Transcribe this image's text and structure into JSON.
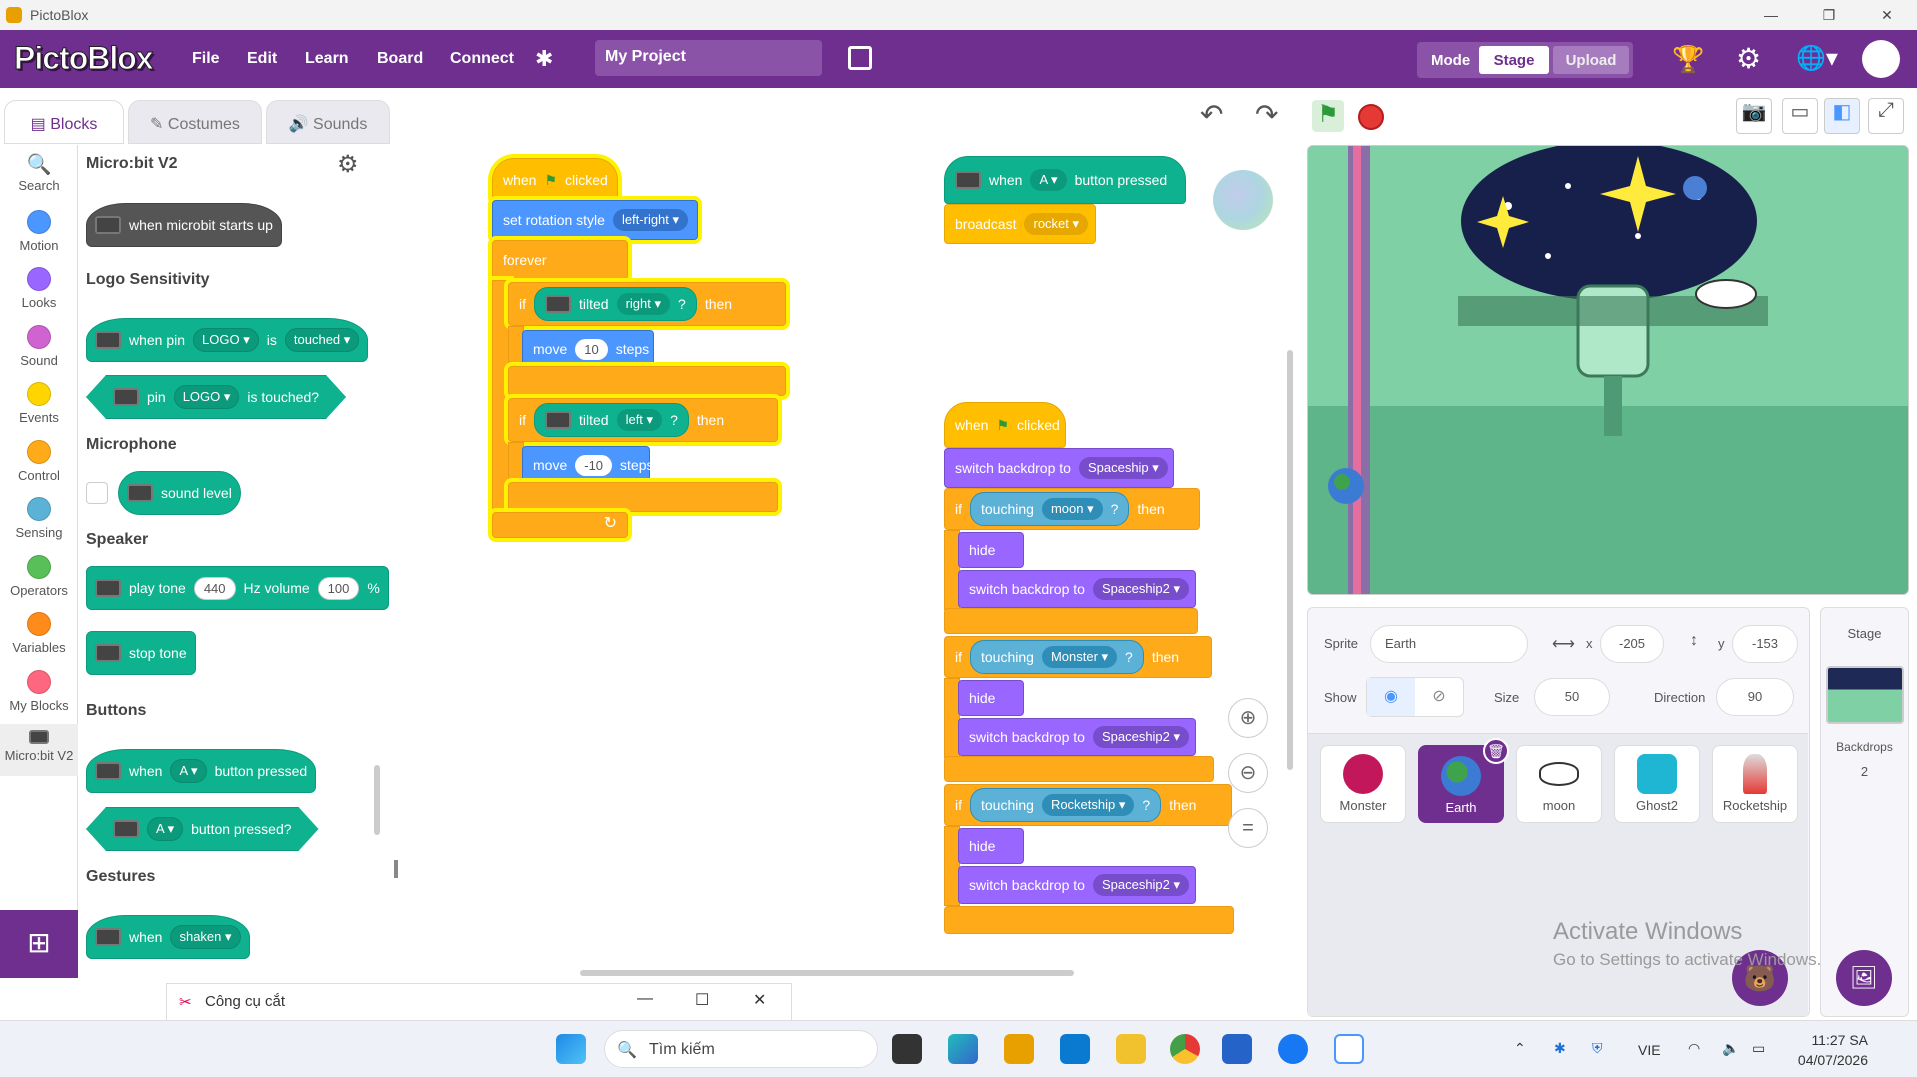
{
  "window": {
    "title": "PictoBlox"
  },
  "menubar": {
    "brand": "PictoBlox",
    "items": [
      "File",
      "Edit",
      "Learn",
      "Board",
      "Connect"
    ],
    "project_name": "My Project",
    "mode_label": "Mode",
    "stage_label": "Stage",
    "upload_label": "Upload"
  },
  "tabs": {
    "blocks": "Blocks",
    "costumes": "Costumes",
    "sounds": "Sounds"
  },
  "categories": [
    "Search",
    "Motion",
    "Looks",
    "Sound",
    "Events",
    "Control",
    "Sensing",
    "Operators",
    "Variables",
    "My Blocks",
    "Micro:bit V2"
  ],
  "category_colors": [
    "#4c97ff",
    "#4c97ff",
    "#9966ff",
    "#cf63cf",
    "#ffd500",
    "#ffab19",
    "#5cb1d6",
    "#59c059",
    "#ff8c1a",
    "#ff6680",
    "#555555"
  ],
  "palette": {
    "title": "Micro:bit V2",
    "start_block": "when microbit starts up",
    "logo_heading": "Logo Sensitivity",
    "when_pin": {
      "w1": "when pin",
      "pin": "LOGO",
      "w2": "is",
      "state": "touched"
    },
    "pin_touched": {
      "w1": "pin",
      "pin": "LOGO",
      "w2": "is touched?"
    },
    "mic_heading": "Microphone",
    "sound_level": "sound level",
    "speaker_heading": "Speaker",
    "play_tone": {
      "w1": "play tone",
      "hz": "440",
      "w2": "Hz volume",
      "vol": "100",
      "w3": "%"
    },
    "stop_tone": "stop tone",
    "buttons_heading": "Buttons",
    "when_button": {
      "w1": "when",
      "btn": "A",
      "w2": "button pressed"
    },
    "button_pressed": {
      "btn": "A",
      "w1": "button pressed?"
    },
    "gestures_heading": "Gestures",
    "when_shaken": {
      "w1": "when",
      "g": "shaken"
    }
  },
  "script1": {
    "when": "when",
    "clicked": "clicked",
    "rotation": "set rotation style",
    "rotation_val": "left-right",
    "forever": "forever",
    "if1": {
      "if": "if",
      "tilted": "tilted",
      "dir": "right",
      "q": "?",
      "then": "then",
      "move": "move",
      "steps_val": "10",
      "steps": "steps"
    },
    "if2": {
      "if": "if",
      "tilted": "tilted",
      "dir": "left",
      "q": "?",
      "then": "then",
      "move": "move",
      "steps_val": "-10",
      "steps": "steps"
    }
  },
  "script2": {
    "when": "when",
    "btn": "A",
    "button_pressed": "button pressed",
    "broadcast": "broadcast",
    "msg": "rocket"
  },
  "script3": {
    "when": "when",
    "clicked": "clicked",
    "switch1": "switch backdrop to",
    "backdrop1": "Spaceship",
    "if": "if",
    "then": "then",
    "q": "?",
    "touching": "touching",
    "hide": "hide",
    "switch": "switch backdrop to",
    "backdrop2": "Spaceship2",
    "t1": "moon",
    "t2": "Monster",
    "t3": "Rocketship"
  },
  "sprite_info": {
    "sprite_label": "Sprite",
    "sprite_name": "Earth",
    "x_label": "x",
    "x": "-205",
    "y_label": "y",
    "y": "-153",
    "show_label": "Show",
    "size_label": "Size",
    "size": "50",
    "dir_label": "Direction",
    "direction": "90"
  },
  "sprites": [
    "Monster",
    "Earth",
    "moon",
    "Ghost2",
    "Rocketship"
  ],
  "stage_panel": {
    "title": "Stage",
    "backdrops_label": "Backdrops",
    "backdrops": "2"
  },
  "watermark": {
    "line1": "Activate Windows",
    "line2": "Go to Settings to activate Windows."
  },
  "snip": {
    "title": "Công cụ cắt"
  },
  "taskbar": {
    "search": "Tìm kiếm",
    "lang": "VIE",
    "time": "11:27 SA",
    "date": "04/07/2026"
  }
}
